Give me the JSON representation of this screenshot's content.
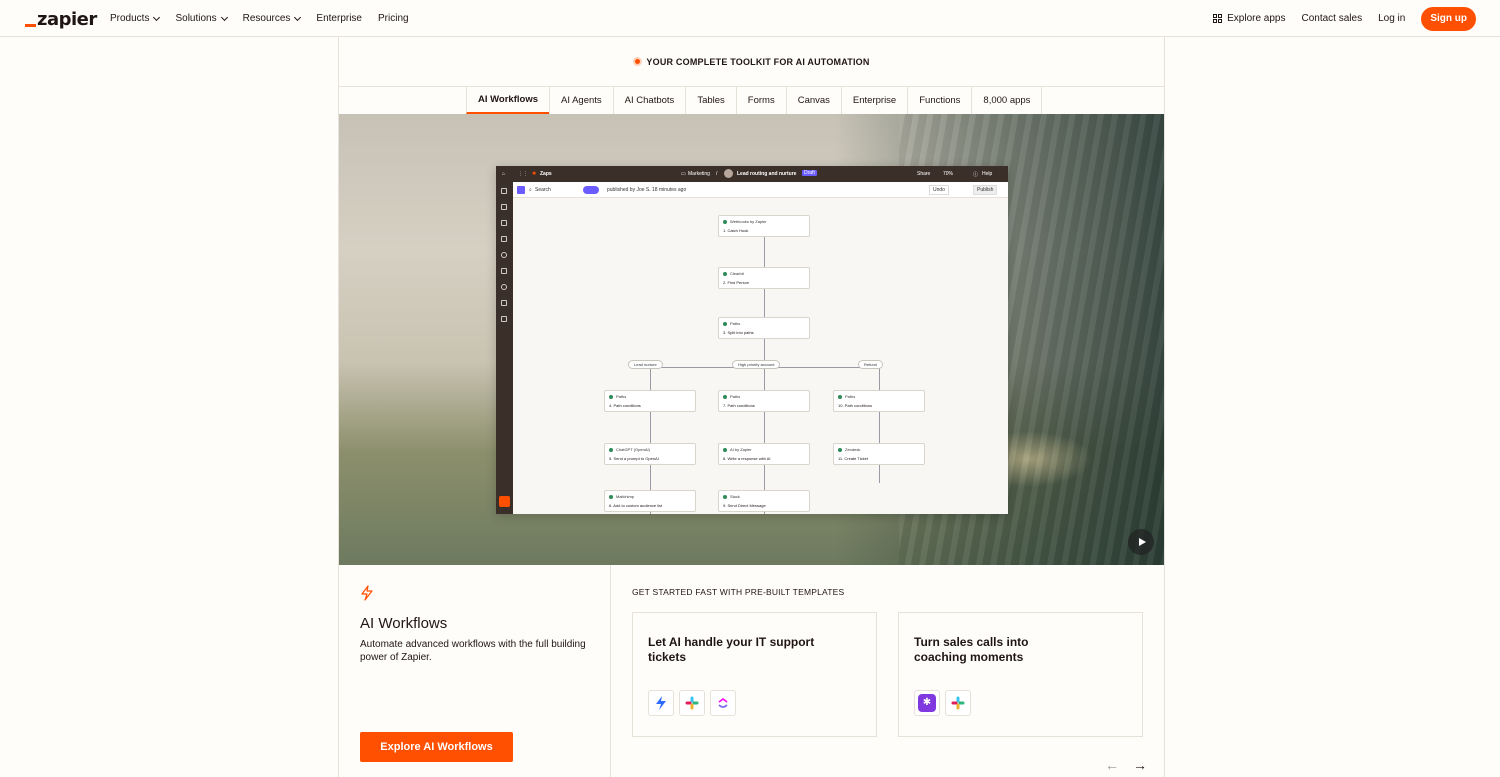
{
  "nav": {
    "logo": "zapier",
    "left_items": [
      {
        "label": "Products",
        "dropdown": true
      },
      {
        "label": "Solutions",
        "dropdown": true
      },
      {
        "label": "Resources",
        "dropdown": true
      },
      {
        "label": "Enterprise",
        "dropdown": false
      },
      {
        "label": "Pricing",
        "dropdown": false
      }
    ],
    "explore_apps": "Explore apps",
    "contact_sales": "Contact sales",
    "login": "Log in",
    "signup": "Sign up"
  },
  "eyebrow": "YOUR COMPLETE TOOLKIT FOR AI AUTOMATION",
  "tabs": [
    {
      "label": "AI Workflows",
      "active": true
    },
    {
      "label": "AI Agents",
      "active": false
    },
    {
      "label": "AI Chatbots",
      "active": false
    },
    {
      "label": "Tables",
      "active": false
    },
    {
      "label": "Forms",
      "active": false
    },
    {
      "label": "Canvas",
      "active": false
    },
    {
      "label": "Enterprise",
      "active": false
    },
    {
      "label": "Functions",
      "active": false
    },
    {
      "label": "8,000 apps",
      "active": false
    }
  ],
  "app_preview": {
    "product": "Zaps",
    "folder": "Marketing",
    "zap_name": "Lead routing and nurture",
    "status": "Draft",
    "share": "Share",
    "zoom": "70%",
    "help": "Help",
    "search": "Search",
    "published": "published by Joe S. 18 minutes ago",
    "undo": "Undo",
    "publish": "Publish",
    "steps": [
      {
        "app": "Webhooks by Zapier",
        "title": "1. Catch Hook"
      },
      {
        "app": "Clearbit",
        "title": "2. Find Person"
      },
      {
        "app": "Paths",
        "title": "3. Split into paths"
      },
      {
        "app": "Paths",
        "title": "4. Path conditions"
      },
      {
        "app": "Paths",
        "title": "7. Path conditions"
      },
      {
        "app": "Paths",
        "title": "10. Path conditions"
      },
      {
        "app": "ChatGPT (OpenAI)",
        "title": "5. Send a prompt to OpenAI"
      },
      {
        "app": "AI by Zapier",
        "title": "8. Write a response with AI"
      },
      {
        "app": "Zendesk",
        "title": "11. Create Ticket"
      },
      {
        "app": "Mailchimp",
        "title": "6. Add to custom audience list"
      },
      {
        "app": "Slack",
        "title": "9. Send Direct Message"
      }
    ],
    "paths": [
      "Lead nurture",
      "High priority account",
      "Refund"
    ]
  },
  "section": {
    "title": "AI Workflows",
    "description": "Automate advanced workflows with the full building power of Zapier.",
    "cta": "Explore AI Workflows"
  },
  "templates": {
    "label": "GET STARTED FAST WITH PRE-BUILT TEMPLATES",
    "cards": [
      {
        "title": "Let AI handle your IT support tickets",
        "apps": [
          "zapier-lightning-icon",
          "slack-icon",
          "clickup-icon"
        ]
      },
      {
        "title": "Turn sales calls into coaching moments",
        "apps": [
          "gong-icon",
          "slack-icon"
        ]
      }
    ]
  },
  "colors": {
    "brand": "#ff4f00",
    "text": "#201515",
    "border": "#e6e1d9",
    "background": "#fffdf9"
  }
}
